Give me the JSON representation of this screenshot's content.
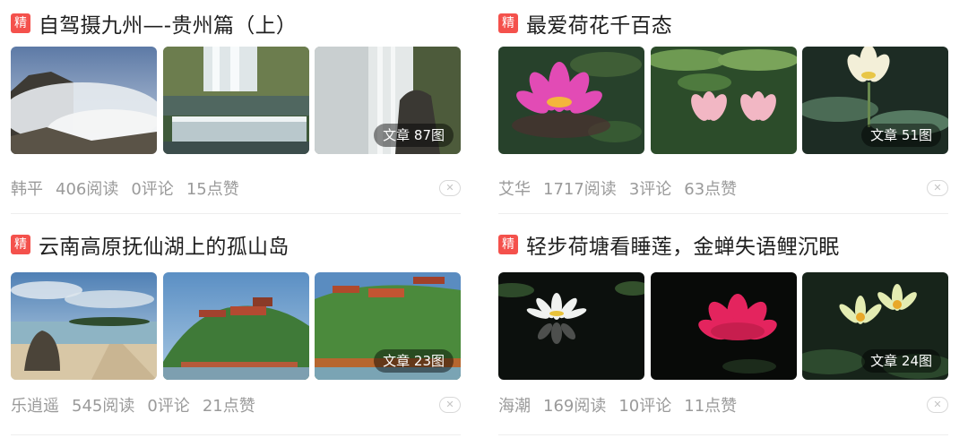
{
  "badge_text": "精",
  "close_symbol": "✕",
  "cards": [
    {
      "title": "自驾摄九州—-贵州篇（上）",
      "count_label": "文章",
      "count": "87图",
      "author": "韩平",
      "reads": "406阅读",
      "comments": "0评论",
      "likes": "15点赞"
    },
    {
      "title": "最爱荷花千百态",
      "count_label": "文章",
      "count": "51图",
      "author": "艾华",
      "reads": "1717阅读",
      "comments": "3评论",
      "likes": "63点赞"
    },
    {
      "title": "云南高原抚仙湖上的孤山岛",
      "count_label": "文章",
      "count": "23图",
      "author": "乐逍遥",
      "reads": "545阅读",
      "comments": "0评论",
      "likes": "21点赞"
    },
    {
      "title": "轻步荷塘看睡莲，金蝉失语鲤沉眠",
      "count_label": "文章",
      "count": "24图",
      "author": "海潮",
      "reads": "169阅读",
      "comments": "10评论",
      "likes": "11点赞"
    }
  ],
  "colors": {
    "badge": "#f4514c",
    "title": "#1f1f1f",
    "meta": "#9a9a9a"
  }
}
